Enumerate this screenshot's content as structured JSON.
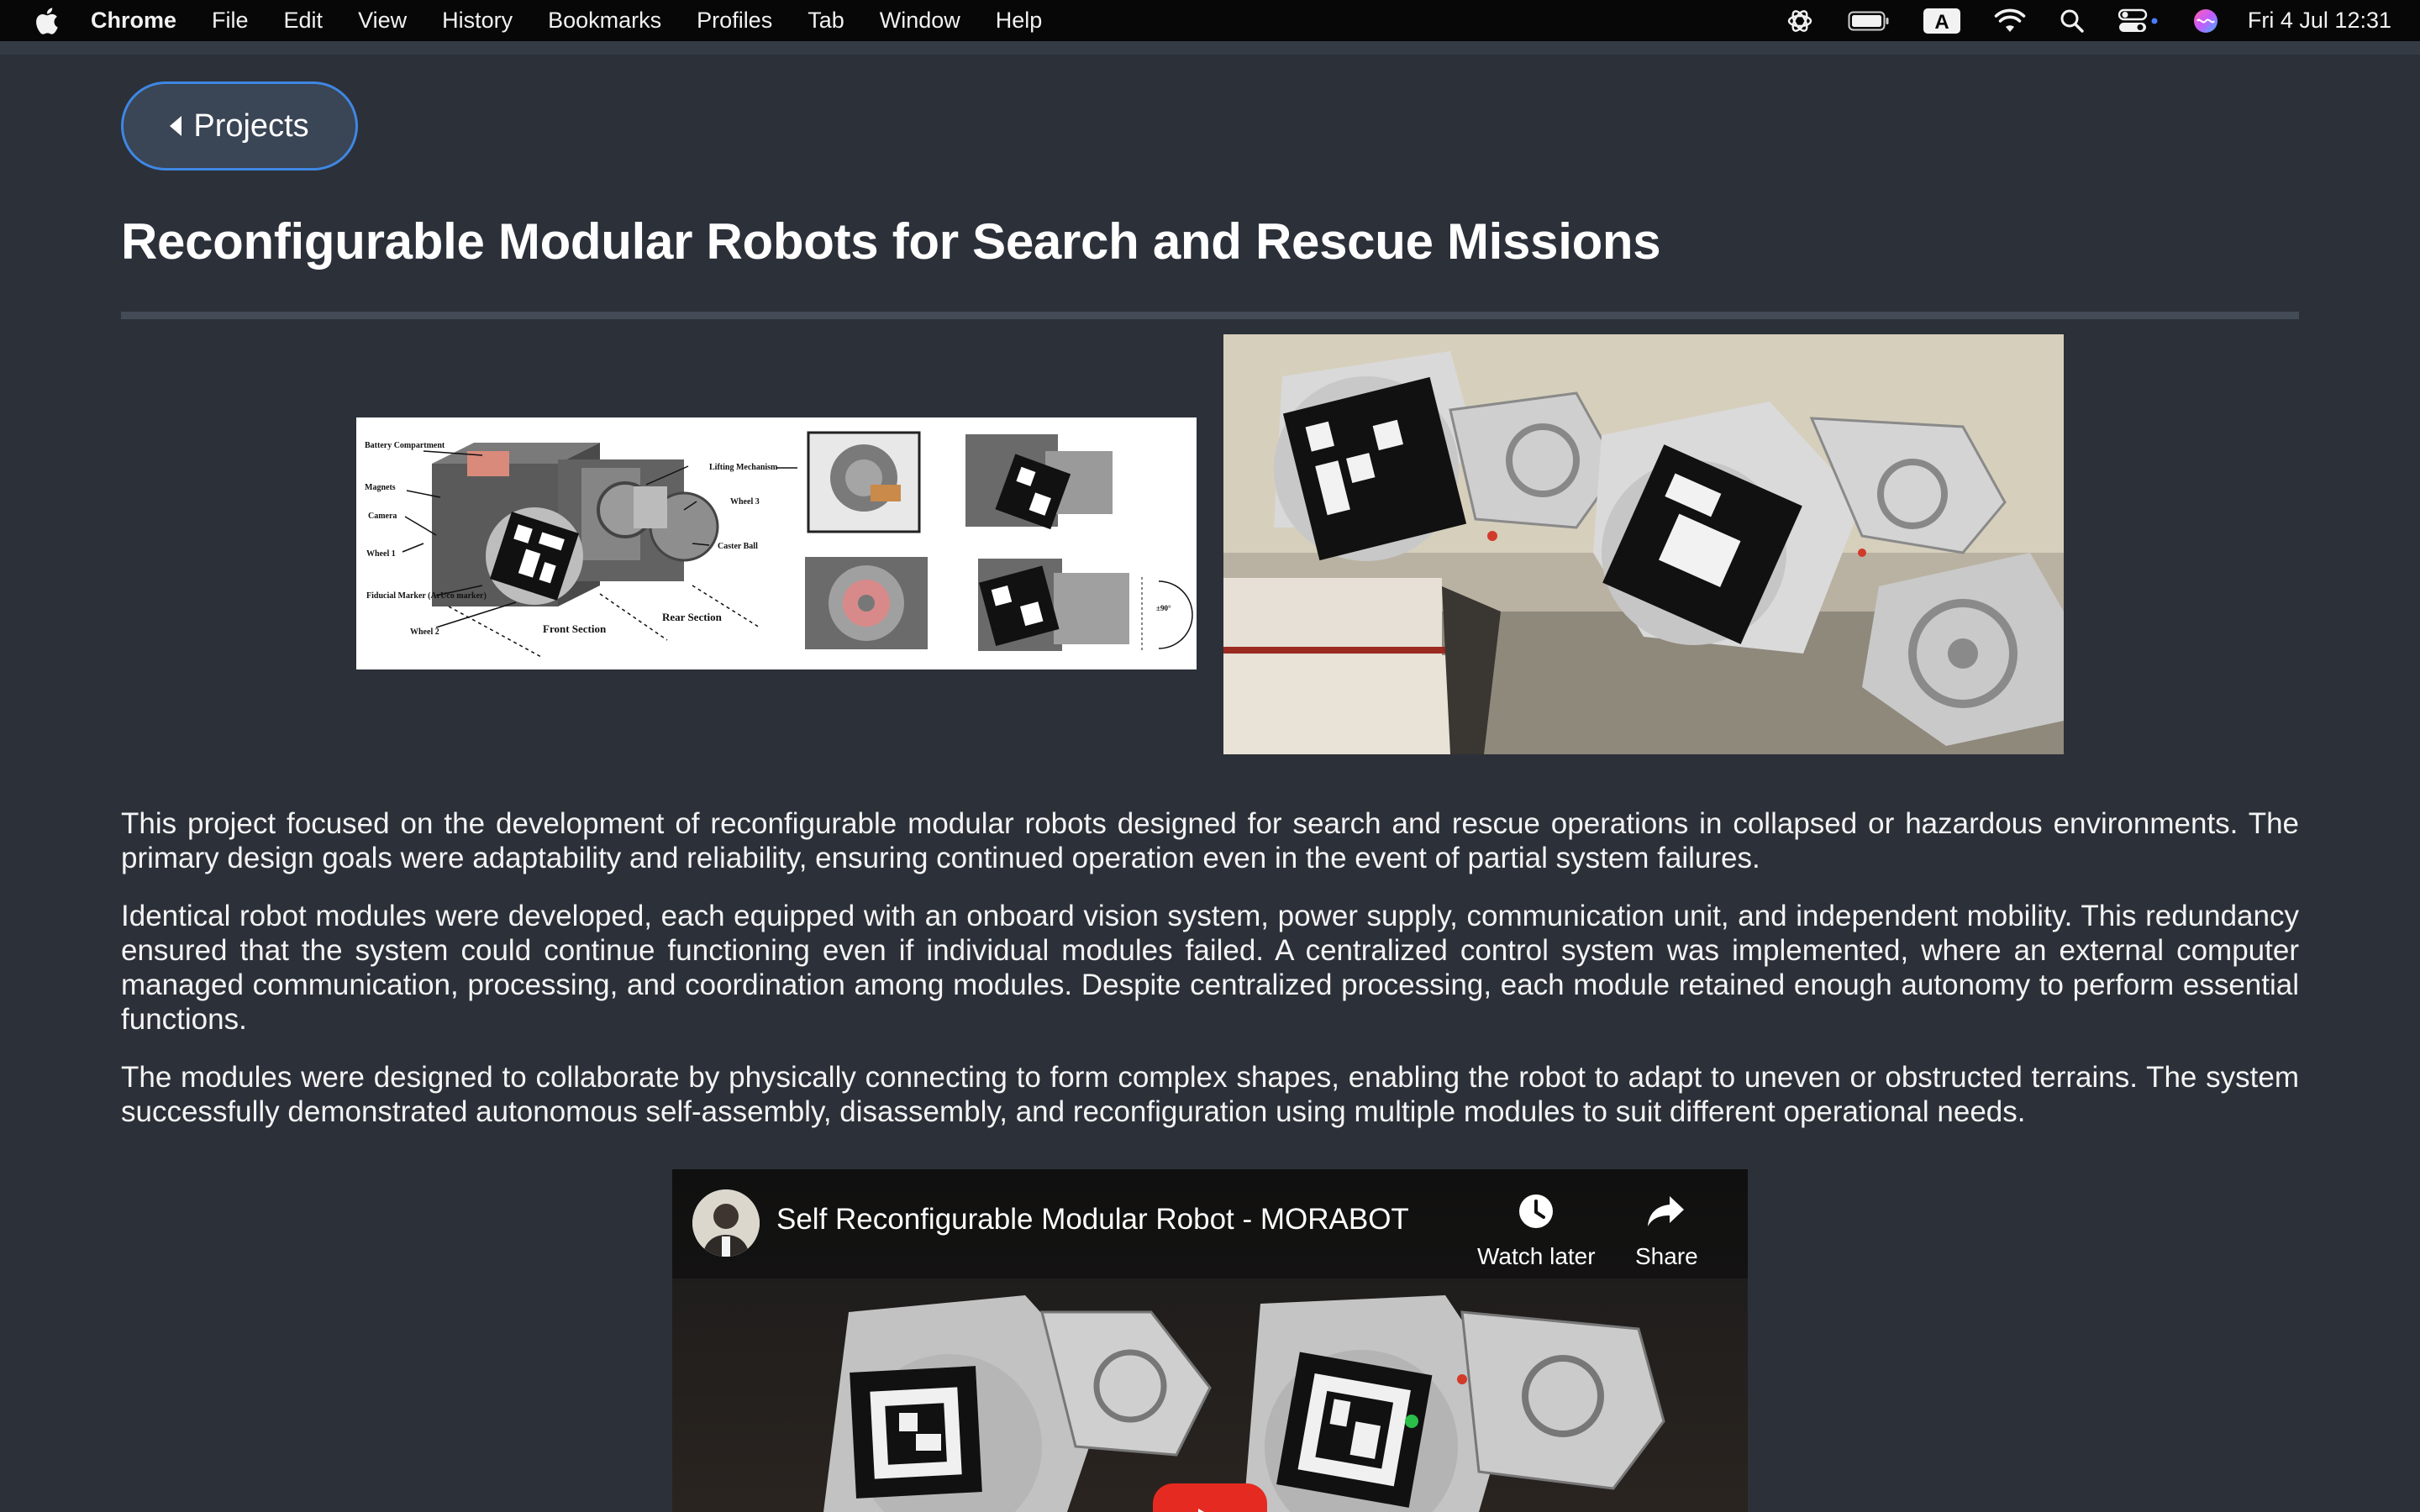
{
  "menubar": {
    "app_name": "Chrome",
    "items": [
      "File",
      "Edit",
      "View",
      "History",
      "Bookmarks",
      "Profiles",
      "Tab",
      "Window",
      "Help"
    ],
    "status_icons": [
      "chatgpt-icon",
      "battery-icon",
      "input-source-icon",
      "wifi-icon",
      "spotlight-icon",
      "control-center-icon",
      "siri-icon"
    ],
    "input_source_label": "A",
    "clock": "Fri 4 Jul  12:31"
  },
  "page": {
    "back_label": "Projects",
    "title": "Reconfigurable Modular Robots for Search and Rescue Missions",
    "figure1": {
      "labels": {
        "battery": "Battery Compartment",
        "magnets": "Magnets",
        "camera": "Camera",
        "wheel1": "Wheel 1",
        "fiducial": "Fiducial Marker (ArUco marker)",
        "wheel2": "Wheel 2",
        "front": "Front Section",
        "rear": "Rear Section",
        "caster": "Caster Ball",
        "wheel3": "Wheel 3",
        "lifting": "Lifting Mechanism",
        "angle": "±90°"
      }
    },
    "paragraphs": [
      "This project focused on the development of reconfigurable modular robots designed for search and rescue operations in collapsed or hazardous environments. The primary design goals were adaptability and reliability, ensuring continued operation even in the event of partial system failures.",
      "Identical robot modules were developed, each equipped with an onboard vision system, power supply, communication unit, and independent mobility. This redundancy ensured that the system could continue functioning even if individual modules failed. A centralized control system was implemented, where an external computer managed communication, processing, and coordination among modules. Despite centralized processing, each module retained enough autonomy to perform essential functions.",
      "The modules were designed to collaborate by physically connecting to form complex shapes, enabling the robot to adapt to uneven or obstructed terrains. The system successfully demonstrated autonomous self-assembly, disassembly, and reconfiguration using multiple modules to suit different operational needs."
    ],
    "video": {
      "title": "Self Reconfigurable Modular Robot - MORABOT",
      "watch_later": "Watch later",
      "share": "Share"
    }
  },
  "colors": {
    "background": "#2c3039",
    "button_border": "#3f87e3",
    "button_fill": "#3a4555",
    "rule": "#434b57",
    "play_red": "#e52b21"
  }
}
